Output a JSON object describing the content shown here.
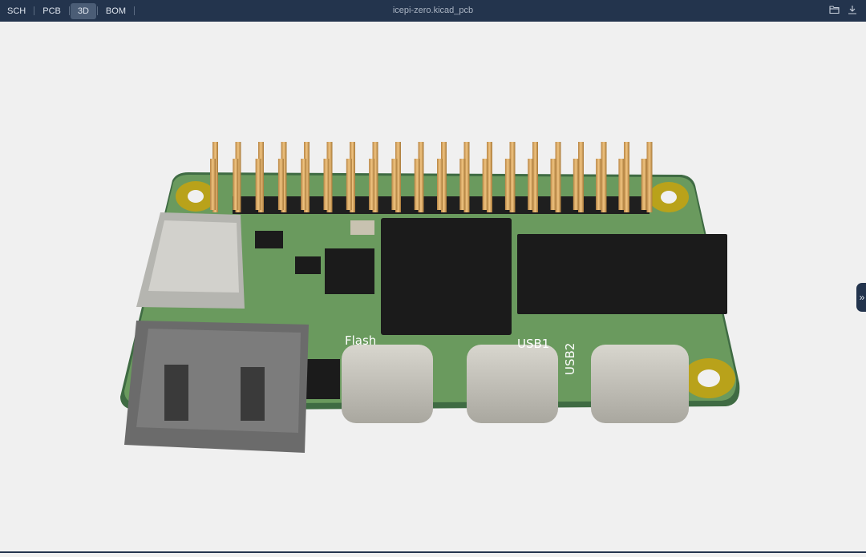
{
  "tabs": [
    {
      "label": "SCH"
    },
    {
      "label": "PCB"
    },
    {
      "label": "3D"
    },
    {
      "label": "BOM"
    }
  ],
  "active_tab": "3D",
  "file_title": "icepi-zero.kicad_pcb",
  "icons": {
    "open": "folder-open-icon",
    "download": "download-icon",
    "expand": "chevron-double-right-icon"
  },
  "expand_label": "»",
  "board_labels": {
    "flash": "Flash",
    "usb1": "USB1",
    "usb2": "USB2"
  },
  "colors": {
    "topbar": "#23344d",
    "active_tab": "#4b5d76",
    "pcb": "#5e8f5a",
    "pins": "#d9a860",
    "chip": "#1b1b1b"
  }
}
